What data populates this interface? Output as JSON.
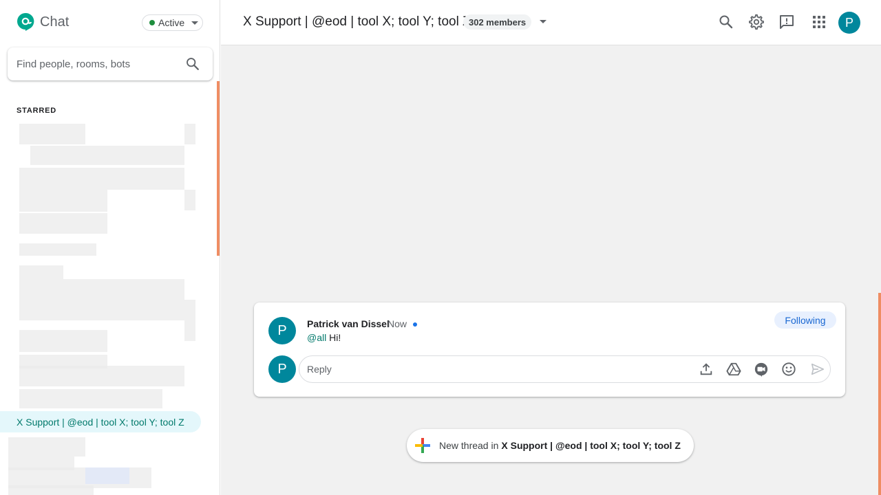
{
  "app": {
    "name": "Chat",
    "status": "Active",
    "colors": {
      "accent": "#00879c",
      "status_active": "#1e8e3e",
      "scroll_accent": "#ef8d63",
      "link_blue": "#1967d2"
    }
  },
  "sidebar": {
    "search_placeholder": "Find people, rooms, bots",
    "section_label": "STARRED",
    "active_room": "X Support | @eod | tool X; tool Y; tool Z"
  },
  "header": {
    "room_title": "X Support | @eod | tool X; tool Y; tool Z",
    "members": "302 members",
    "icons": [
      "search-icon",
      "settings-icon",
      "feedback-icon",
      "apps-icon"
    ],
    "avatar_initial": "P"
  },
  "thread": {
    "author_initial": "P",
    "author": "Patrick van Dissel",
    "time": "Now",
    "mention": "@all",
    "text": "Hi!",
    "following_label": "Following",
    "reply_placeholder": "Reply",
    "reply_avatar_initial": "P",
    "reply_icons": [
      "upload-icon",
      "drive-icon",
      "meet-icon",
      "emoji-icon",
      "send-icon"
    ]
  },
  "new_thread": {
    "prefix": "New thread in",
    "room": "X Support | @eod | tool X; tool Y; tool Z"
  }
}
